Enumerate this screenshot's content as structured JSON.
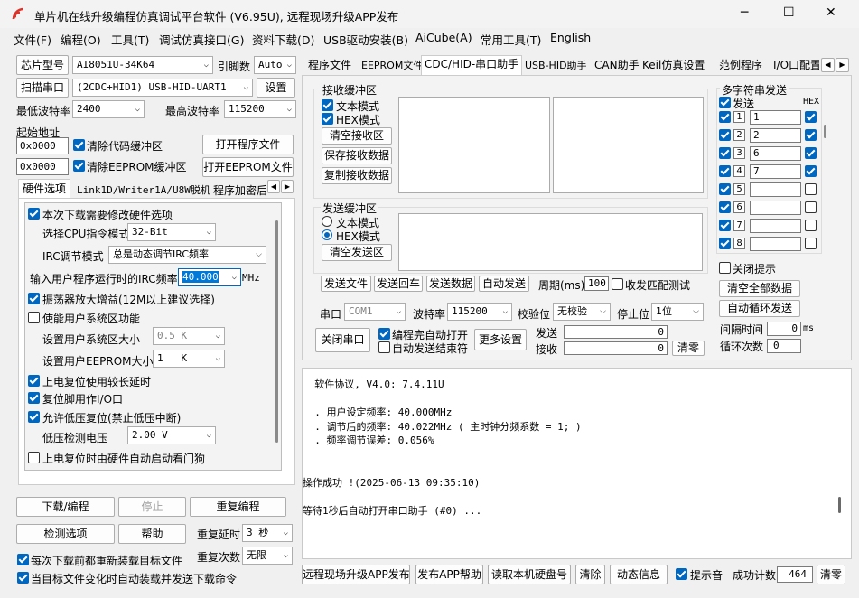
{
  "window": {
    "title": "单片机在线升级编程仿真调试平台软件 (V6.95U), 远程现场升级APP发布",
    "minimize": "─",
    "maximize": "☐",
    "close": "✕"
  },
  "menu": [
    "文件(F)",
    "编程(O)",
    "工具(T)",
    "调试仿真接口(G)",
    "资料下载(D)",
    "USB驱动安装(B)",
    "AiCube(A)",
    "常用工具(T)",
    "English"
  ],
  "left": {
    "chip_model_btn": "芯片型号",
    "chip_model": "AI8051U-34K64",
    "pin_count_label": "引脚数",
    "pin_count": "Auto",
    "scan_port_btn": "扫描串口",
    "port": "(2CDC+HID1) USB-HID-UART1",
    "settings_btn": "设置",
    "min_baud_label": "最低波特率",
    "min_baud": "2400",
    "max_baud_label": "最高波特率",
    "max_baud": "115200",
    "start_addr_label": "起始地址",
    "addr1": "0x0000",
    "clear_code_buf": "清除代码缓冲区",
    "open_prog_btn": "打开程序文件",
    "addr2": "0x0000",
    "clear_eeprom_buf": "清除EEPROM缓冲区",
    "open_eeprom_btn": "打开EEPROM文件",
    "tabs": [
      "硬件选项",
      "Link1D/Writer1A/U8W脱机",
      "程序加密后"
    ],
    "hw": {
      "modify_hw": "本次下载需要修改硬件选项",
      "cpu_mode_label": "选择CPU指令模式",
      "cpu_mode": "32-Bit",
      "irc_mode_label": "IRC调节模式",
      "irc_mode": "总是动态调节IRC频率",
      "irc_freq_label": "输入用户程序运行时的IRC频率",
      "irc_freq": "40.000",
      "irc_unit": "MHz",
      "osc_gain": "振荡器放大增益(12M以上建议选择)",
      "user_sys_area": "使能用户系统区功能",
      "user_sys_size_label": "设置用户系统区大小",
      "user_sys_size": "0.5 K",
      "eeprom_size_label": "设置用户EEPROM大小",
      "eeprom_size": "1   K",
      "long_reset": "上电复位使用较长延时",
      "reset_io": "复位脚用作I/O口",
      "lvr": "允许低压复位(禁止低压中断)",
      "lvd_label": "低压检测电压",
      "lvd": "2.00 V",
      "watchdog": "上电复位时由硬件自动启动看门狗"
    },
    "download_btn": "下载/编程",
    "stop_btn": "停止",
    "repeat_btn": "重复编程",
    "detect_btn": "检测选项",
    "help_btn": "帮助",
    "repeat_delay_label": "重复延时",
    "repeat_delay": "3 秒",
    "repeat_count_label": "重复次数",
    "repeat_count": "无限",
    "reload_target": "每次下载前都重新装载目标文件",
    "auto_send": "当目标文件变化时自动装载并发送下载命令"
  },
  "right": {
    "tabs": [
      "程序文件",
      "EEPROM文件",
      "CDC/HID-串口助手",
      "USB-HID助手",
      "CAN助手",
      "Keil仿真设置",
      "范例程序",
      "I/O口配置"
    ],
    "recv": {
      "title": "接收缓冲区",
      "text_mode": "文本模式",
      "hex_mode": "HEX模式",
      "clear_btn": "清空接收区",
      "save_btn": "保存接收数据",
      "copy_btn": "复制接收数据"
    },
    "send": {
      "title": "发送缓冲区",
      "text_mode": "文本模式",
      "hex_mode": "HEX模式",
      "clear_btn": "清空发送区",
      "send_file_btn": "发送文件",
      "send_enter_btn": "发送回车",
      "send_data_btn": "发送数据",
      "auto_send_btn": "自动发送",
      "period_label": "周期(ms)",
      "period": "100",
      "match_test": "收发匹配测试"
    },
    "multi": {
      "title": "多字符串发送",
      "send_label": "发送",
      "hex_label": "HEX",
      "rows": [
        {
          "n": "1",
          "v": "1",
          "hex": true
        },
        {
          "n": "2",
          "v": "2",
          "hex": true
        },
        {
          "n": "3",
          "v": "6",
          "hex": true
        },
        {
          "n": "4",
          "v": "7",
          "hex": true
        },
        {
          "n": "5",
          "v": "",
          "hex": false
        },
        {
          "n": "6",
          "v": "",
          "hex": false
        },
        {
          "n": "7",
          "v": "",
          "hex": false
        },
        {
          "n": "8",
          "v": "",
          "hex": false
        }
      ],
      "close_hint": "关闭提示",
      "clear_all_btn": "清空全部数据",
      "auto_loop_btn": "自动循环发送",
      "interval_label": "间隔时间",
      "interval": "0",
      "interval_unit": "ms",
      "loop_count_label": "循环次数",
      "loop_count": "0"
    },
    "port": {
      "port_label": "串口",
      "port": "COM1",
      "baud_label": "波特率",
      "baud": "115200",
      "parity_label": "校验位",
      "parity": "无校验",
      "stop_label": "停止位",
      "stop": "1位",
      "close_port_btn": "关闭串口",
      "auto_open": "编程完自动打开",
      "auto_end": "自动发送结束符",
      "more_btn": "更多设置",
      "send_label": "发送",
      "send_count": "0",
      "recv_label": "接收",
      "recv_count": "0",
      "clear_btn": "清零"
    },
    "log": [
      "  软件协议, V4.0: 7.4.11U",
      "",
      "  . 用户设定频率: 40.000MHz",
      "  . 调节后的频率: 40.022MHz ( 主时钟分频系数 = 1; )",
      "  . 频率调节误差: 0.056%",
      "",
      "",
      "操作成功 !(2025-06-13 09:35:10)",
      "",
      "等待1秒后自动打开串口助手 (#0) ..."
    ],
    "bottom": {
      "remote_btn": "远程现场升级APP发布",
      "help_btn": "发布APP帮助",
      "disk_btn": "读取本机硬盘号",
      "clear_btn": "清除",
      "anim_btn": "动态信息",
      "sound": "提示音",
      "success_label": "成功计数",
      "success_count": "464",
      "reset_btn": "清零"
    }
  }
}
